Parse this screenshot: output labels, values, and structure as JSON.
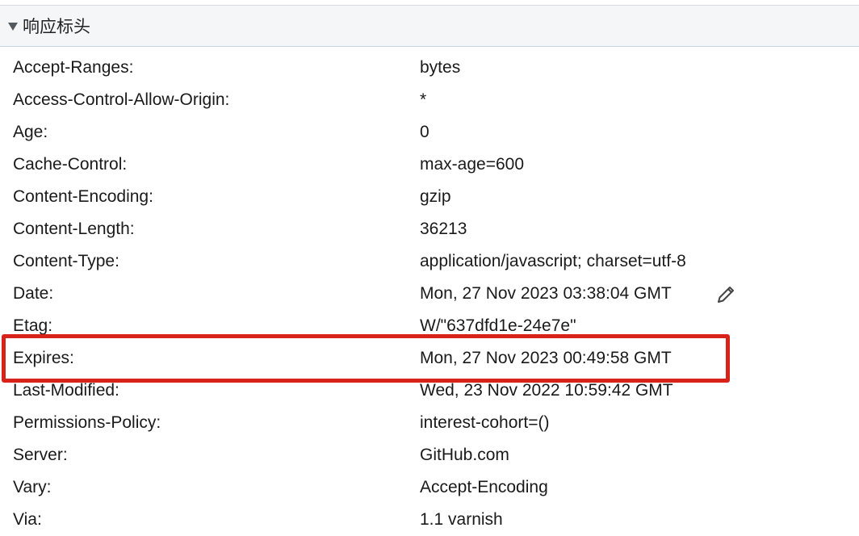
{
  "section": {
    "title": "响应标头",
    "expanded": true
  },
  "headers": [
    {
      "name": "Accept-Ranges:",
      "value": "bytes"
    },
    {
      "name": "Access-Control-Allow-Origin:",
      "value": "*"
    },
    {
      "name": "Age:",
      "value": "0"
    },
    {
      "name": "Cache-Control:",
      "value": "max-age=600"
    },
    {
      "name": "Content-Encoding:",
      "value": "gzip"
    },
    {
      "name": "Content-Length:",
      "value": "36213"
    },
    {
      "name": "Content-Type:",
      "value": "application/javascript; charset=utf-8"
    },
    {
      "name": "Date:",
      "value": "Mon, 27 Nov 2023 03:38:04 GMT"
    },
    {
      "name": "Etag:",
      "value": "W/\"637dfd1e-24e7e\""
    },
    {
      "name": "Expires:",
      "value": "Mon, 27 Nov 2023 00:49:58 GMT"
    },
    {
      "name": "Last-Modified:",
      "value": "Wed, 23 Nov 2022 10:59:42 GMT"
    },
    {
      "name": "Permissions-Policy:",
      "value": "interest-cohort=()"
    },
    {
      "name": "Server:",
      "value": "GitHub.com"
    },
    {
      "name": "Vary:",
      "value": "Accept-Encoding"
    },
    {
      "name": "Via:",
      "value": "1.1 varnish"
    }
  ],
  "highlight": {
    "header": "Expires:",
    "color": "#d8231b"
  },
  "icons": {
    "toggle": "triangle-down-icon",
    "edit": "pencil-icon"
  }
}
